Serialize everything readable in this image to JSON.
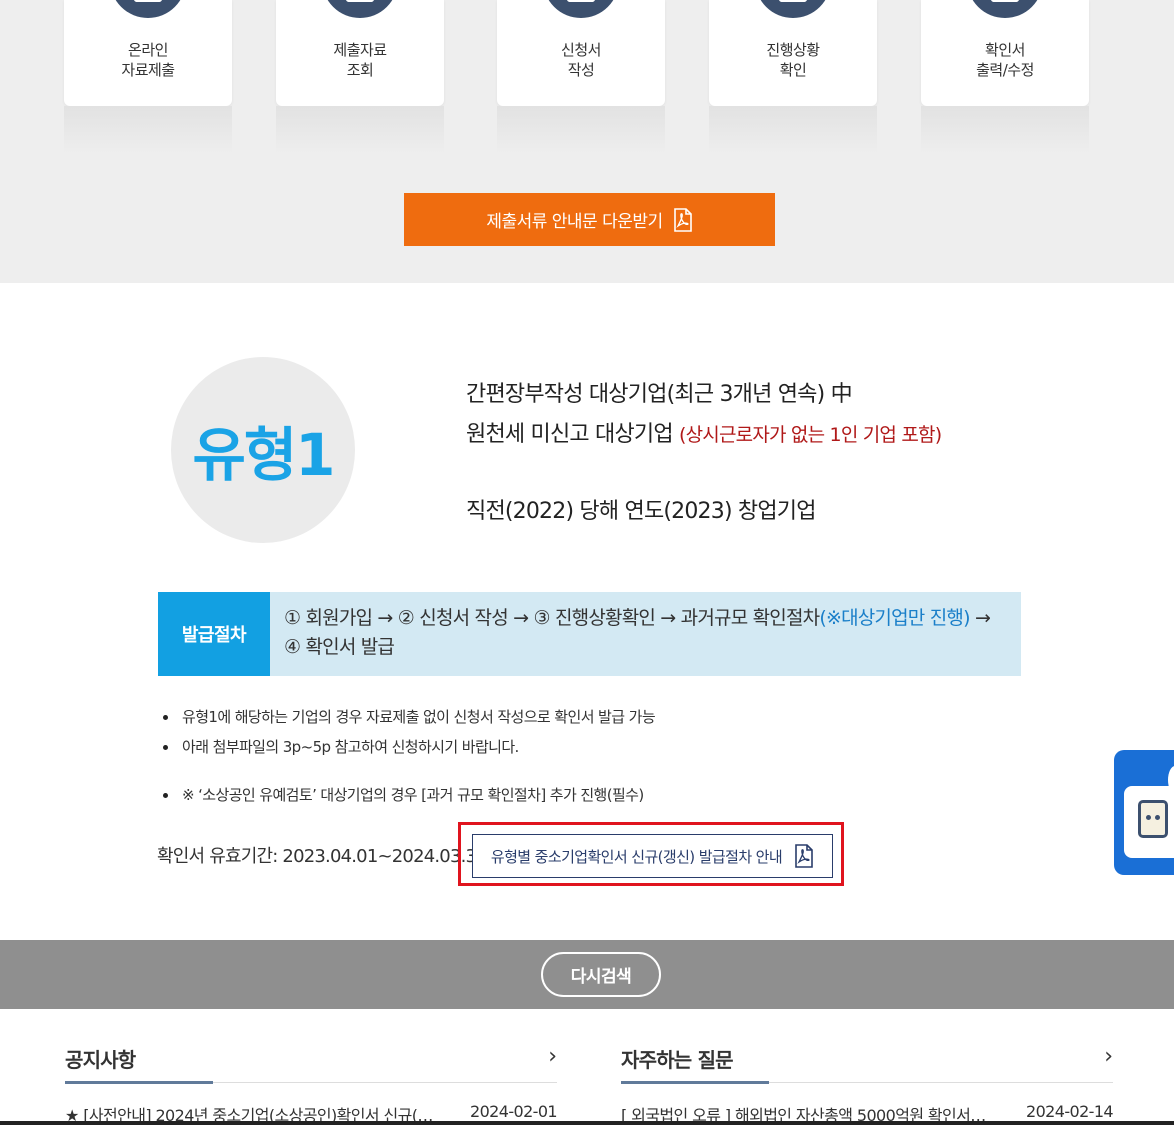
{
  "cards": [
    {
      "line1": "온라인",
      "line2": "자료제출"
    },
    {
      "line1": "제출자료",
      "line2": "조회"
    },
    {
      "line1": "신청서",
      "line2": "작성"
    },
    {
      "line1": "진행상황",
      "line2": "확인"
    },
    {
      "line1": "확인서",
      "line2": "출력/수정"
    }
  ],
  "download_button": {
    "label": "제출서류 안내문 다운받기",
    "icon": "pdf-icon"
  },
  "type_badge": "유형1",
  "description": {
    "line1": "간편장부작성 대상기업(최근 3개년 연속) 中",
    "line2_main": "원천세 미신고 대상기업",
    "line2_red": "(상시근로자가 없는 1인 기업 포함)",
    "line3": "직전(2022) 당해 연도(2023) 창업기업"
  },
  "procedure": {
    "head": "발급절차",
    "text_before": "① 회원가입 → ② 신청서 작성 → ③ 진행상황확인 → 과거규모 확인절차",
    "text_highlight": "(※대상기업만 진행)",
    "text_after": " → ④ 확인서 발급"
  },
  "bullets": [
    "유형1에 해당하는 기업의 경우 자료제출 없이 신청서 작성으로 확인서 발급 가능",
    "아래 첨부파일의 3p~5p 참고하여 신청하시기 바랍니다."
  ],
  "bullet_note": "※ ‘소상공인 유예검토’ 대상기업의 경우 [과거 규모 확인절차] 추가 진행(필수)",
  "validity": "확인서 유효기간: 2023.04.01~2024.03.31",
  "guide_button": {
    "label": "유형별 중소기업확인서 신규(갱신) 발급절차 안내",
    "icon": "pdf-icon"
  },
  "research_button": "다시검색",
  "notice": {
    "title": "공지사항",
    "more": "›",
    "item_text": "★ [사전안내] 2024년 중소기업(소상공인)확인서 신규(…",
    "item_date": "2024-02-01"
  },
  "faq": {
    "title": "자주하는 질문",
    "more": "›",
    "item_text": "[ 외국법인 오류 ] 해외법인 자산총액 5000억원 확인서…",
    "item_date": "2024-02-14"
  },
  "colors": {
    "orange": "#ef6c0f",
    "blue": "#12a0e2",
    "navy": "#2a3d6b",
    "red": "#e0141e"
  }
}
